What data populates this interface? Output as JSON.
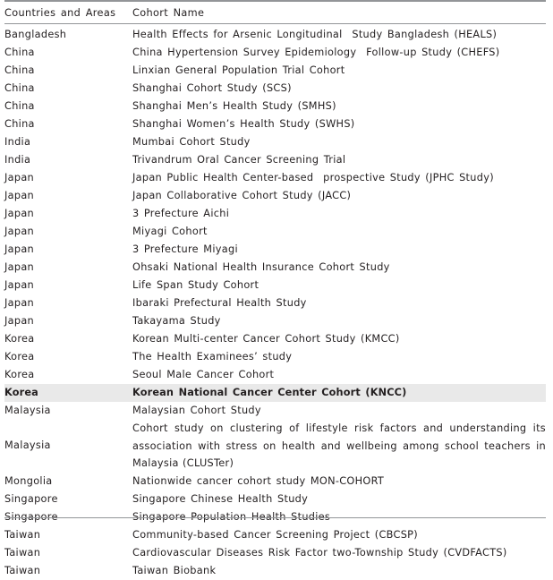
{
  "table": {
    "caption": "",
    "columns": [
      {
        "key": "country",
        "label": "Countries and Areas"
      },
      {
        "key": "cohort",
        "label": "Cohort Name"
      }
    ],
    "rows": [
      {
        "country": "Bangladesh",
        "cohort": "Health Effects for Arsenic Longitudinal  Study Bangladesh (HEALS)",
        "highlighted": false,
        "multiline": false
      },
      {
        "country": "China",
        "cohort": "China Hypertension Survey Epidemiology  Follow-up Study (CHEFS)",
        "highlighted": false,
        "multiline": false
      },
      {
        "country": "China",
        "cohort": "Linxian General Population Trial Cohort",
        "highlighted": false,
        "multiline": false
      },
      {
        "country": "China",
        "cohort": "Shanghai Cohort Study (SCS)",
        "highlighted": false,
        "multiline": false
      },
      {
        "country": "China",
        "cohort": "Shanghai Men’s Health Study (SMHS)",
        "highlighted": false,
        "multiline": false
      },
      {
        "country": "China",
        "cohort": "Shanghai Women’s Health Study (SWHS)",
        "highlighted": false,
        "multiline": false
      },
      {
        "country": "India",
        "cohort": "Mumbai Cohort Study",
        "highlighted": false,
        "multiline": false
      },
      {
        "country": "India",
        "cohort": "Trivandrum Oral Cancer Screening Trial",
        "highlighted": false,
        "multiline": false
      },
      {
        "country": "Japan",
        "cohort": "Japan Public Health Center-based  prospective Study (JPHC Study)",
        "highlighted": false,
        "multiline": false
      },
      {
        "country": "Japan",
        "cohort": "Japan Collaborative Cohort Study (JACC)",
        "highlighted": false,
        "multiline": false
      },
      {
        "country": "Japan",
        "cohort": "3 Prefecture Aichi",
        "highlighted": false,
        "multiline": false
      },
      {
        "country": "Japan",
        "cohort": "Miyagi Cohort",
        "highlighted": false,
        "multiline": false
      },
      {
        "country": "Japan",
        "cohort": "3 Prefecture Miyagi",
        "highlighted": false,
        "multiline": false
      },
      {
        "country": "Japan",
        "cohort": "Ohsaki National Health Insurance Cohort Study",
        "highlighted": false,
        "multiline": false
      },
      {
        "country": "Japan",
        "cohort": "Life Span Study Cohort",
        "highlighted": false,
        "multiline": false
      },
      {
        "country": "Japan",
        "cohort": "Ibaraki Prefectural Health Study",
        "highlighted": false,
        "multiline": false
      },
      {
        "country": "Japan",
        "cohort": "Takayama Study",
        "highlighted": false,
        "multiline": false
      },
      {
        "country": "Korea",
        "cohort": "Korean Multi-center Cancer Cohort Study (KMCC)",
        "highlighted": false,
        "multiline": false
      },
      {
        "country": "Korea",
        "cohort": "The Health Examinees’ study",
        "highlighted": false,
        "multiline": false
      },
      {
        "country": "Korea",
        "cohort": "Seoul Male Cancer Cohort",
        "highlighted": false,
        "multiline": false
      },
      {
        "country": "Korea",
        "cohort": "Korean National Cancer Center Cohort (KNCC)",
        "highlighted": true,
        "multiline": false
      },
      {
        "country": "Malaysia",
        "cohort": "Malaysian Cohort Study",
        "highlighted": false,
        "multiline": false
      },
      {
        "country": "Malaysia",
        "cohort": "Cohort study on clustering of lifestyle  risk factors and understanding its association with stress on health and wellbeing among school teachers in Malaysia (CLUSTer)",
        "highlighted": false,
        "multiline": true
      },
      {
        "country": "Mongolia",
        "cohort": "Nationwide cancer cohort study MON-COHORT",
        "highlighted": false,
        "multiline": false
      },
      {
        "country": "Singapore",
        "cohort": "Singapore Chinese Health Study",
        "highlighted": false,
        "multiline": false
      },
      {
        "country": "Singapore",
        "cohort": "Singapore Population Health Studies",
        "highlighted": false,
        "multiline": false
      },
      {
        "country": "Taiwan",
        "cohort": "Community-based Cancer Screening Project (CBCSP)",
        "highlighted": false,
        "multiline": false
      },
      {
        "country": "Taiwan",
        "cohort": "Cardiovascular Diseases Risk Factor two-Township Study (CVDFACTS)",
        "highlighted": false,
        "multiline": false
      },
      {
        "country": "Taiwan",
        "cohort": "Taiwan Biobank",
        "highlighted": false,
        "multiline": false
      }
    ]
  },
  "colors": {
    "rule": "#939598",
    "text": "#231f20",
    "highlight_background": "#e9e9e9"
  }
}
